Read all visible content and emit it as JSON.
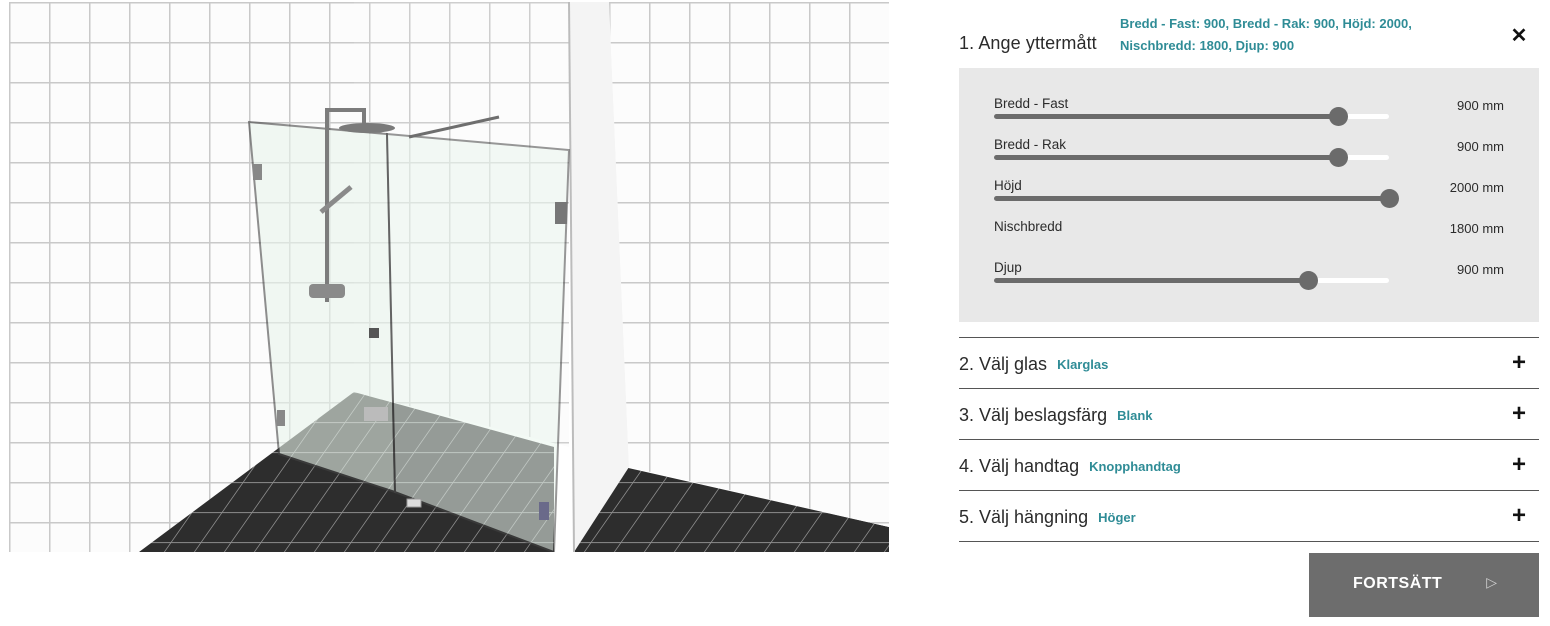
{
  "step1": {
    "title": "1. Ange yttermått",
    "summary": "Bredd - Fast: 900, Bredd - Rak: 900, Höjd: 2000, Nischbredd: 1800, Djup: 900",
    "close_icon": "close-icon",
    "sliders": [
      {
        "label": "Bredd - Fast",
        "value": "900 mm",
        "fraction": 0.87,
        "has_slider": true
      },
      {
        "label": "Bredd - Rak",
        "value": "900 mm",
        "fraction": 0.87,
        "has_slider": true
      },
      {
        "label": "Höjd",
        "value": "2000 mm",
        "fraction": 1.0,
        "has_slider": true
      },
      {
        "label": "Nischbredd",
        "value": "1800 mm",
        "has_slider": false
      },
      {
        "label": "Djup",
        "value": "900 mm",
        "fraction": 0.795,
        "has_slider": true
      }
    ]
  },
  "steps": [
    {
      "title": "2. Välj glas",
      "selection": "Klarglas"
    },
    {
      "title": "3. Välj beslagsfärg",
      "selection": "Blank"
    },
    {
      "title": "4. Välj handtag",
      "selection": "Knopphandtag"
    },
    {
      "title": "5. Välj hängning",
      "selection": "Höger"
    }
  ],
  "continue": {
    "label": "FORTSÄTT",
    "icon": "play-arrow-icon"
  },
  "colors": {
    "accent": "#2f8c96",
    "slider": "#6b6b6b",
    "panel_bg": "#e8e8e8",
    "button": "#6d6d6d"
  }
}
